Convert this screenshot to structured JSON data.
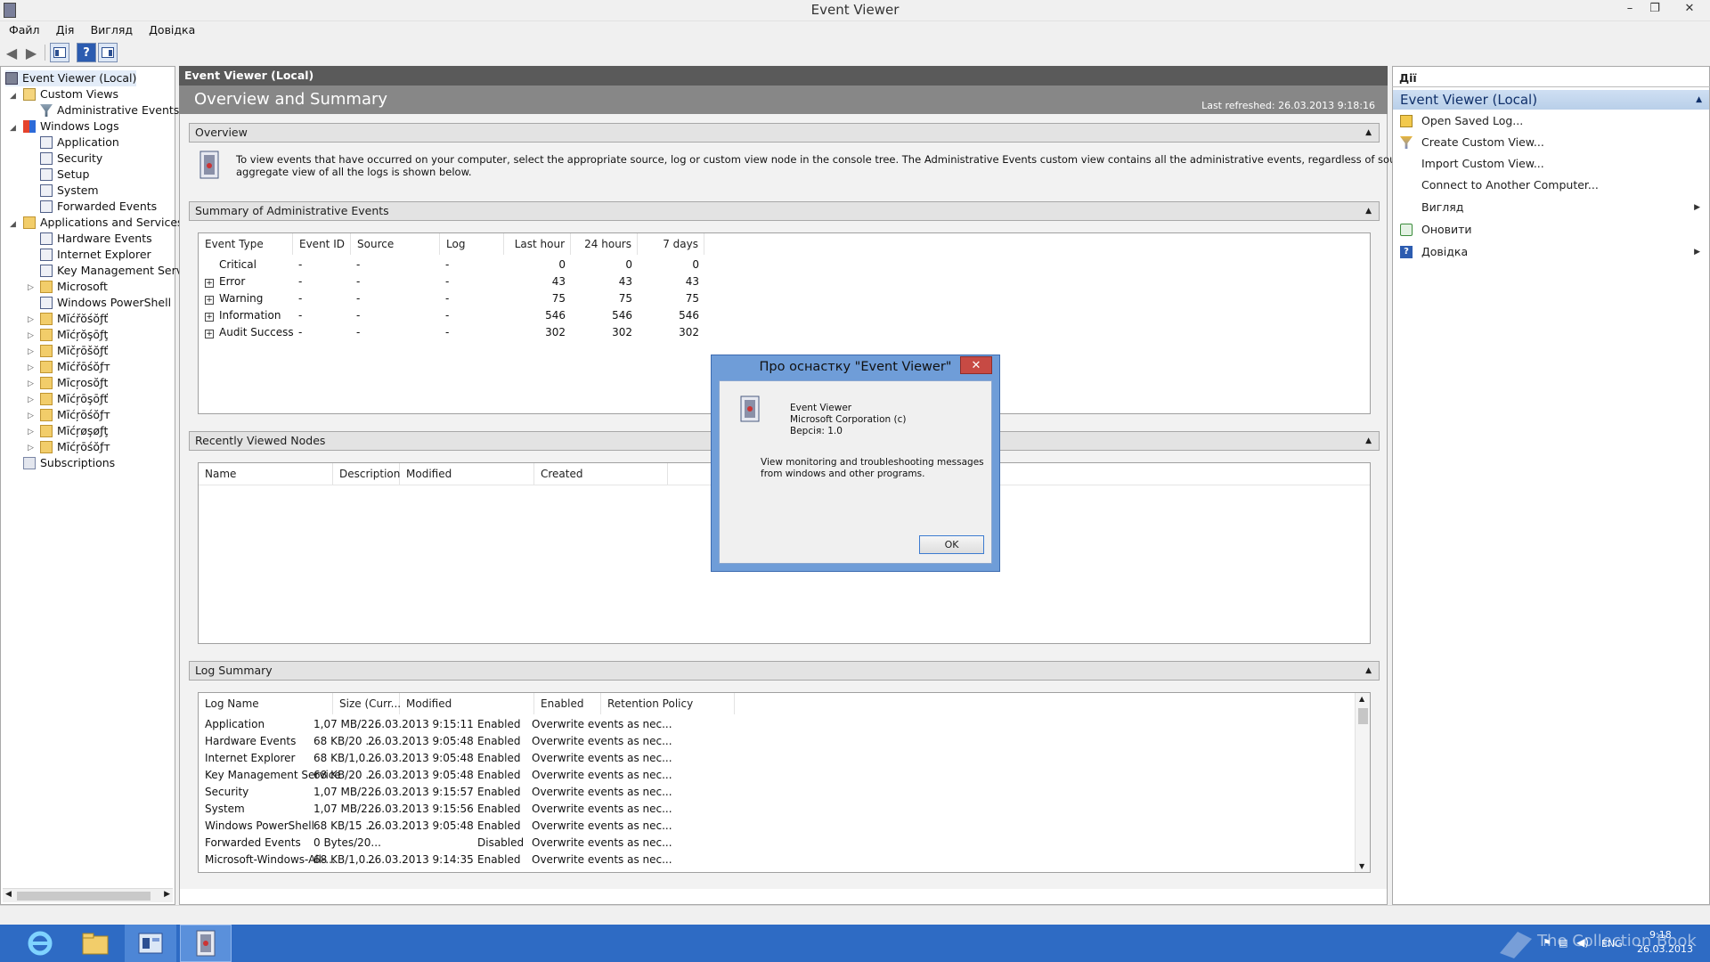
{
  "window": {
    "title": "Event Viewer",
    "minimize": "–",
    "restore": "❐",
    "close": "✕"
  },
  "menu": [
    "Файл",
    "Дія",
    "Вигляд",
    "Довідка"
  ],
  "toolbar": {
    "back": "◀",
    "forward": "▶",
    "help": "?"
  },
  "tree": {
    "root": "Event Viewer (Local)",
    "custom_views": "Custom Views",
    "admin_events": "Administrative Events",
    "windows_logs": "Windows Logs",
    "logs": [
      "Application",
      "Security",
      "Setup",
      "System",
      "Forwarded Events"
    ],
    "apps_services": "Applications and Services Lo",
    "app_logs": [
      "Hardware Events",
      "Internet Explorer",
      "Key Management Service",
      "Microsoft",
      "Windows PowerShell"
    ],
    "microsoft_folders": [
      "Mĭćřŏśŏƒť",
      "Mīćŗŏşōƒţ",
      "Mīčŗōšŏƒť",
      "Mīćřōśŏƒт",
      "Mīcŗosŏƒt",
      "Mīćŗōşōƒť",
      "Mīćŗōśŏƒт",
      "Mīćŗøşøƒţ",
      "Mīćŗōśŏƒт"
    ],
    "subscriptions": "Subscriptions",
    "scroll_left": "◀",
    "scroll_right": "▶"
  },
  "center": {
    "header": "Event Viewer (Local)",
    "title": "Overview and Summary",
    "last_refreshed": "Last refreshed: 26.03.2013 9:18:16",
    "overview": {
      "title": "Overview",
      "text_line1": "To view events that have occurred on your computer, select the appropriate source, log or custom view node in the console tree. The Administrative Events custom view contains all the administrative events, regardless of source. An",
      "text_line2": "aggregate view of all the logs is shown below."
    },
    "summary": {
      "title": "Summary of Administrative Events",
      "columns": [
        "Event Type",
        "Event ID",
        "Source",
        "Log",
        "Last hour",
        "24 hours",
        "7 days"
      ],
      "rows": [
        {
          "type": "Critical",
          "id": "-",
          "source": "-",
          "log": "-",
          "hour": "0",
          "day": "0",
          "week": "0",
          "expand": ""
        },
        {
          "type": "Error",
          "id": "-",
          "source": "-",
          "log": "-",
          "hour": "43",
          "day": "43",
          "week": "43",
          "expand": "+"
        },
        {
          "type": "Warning",
          "id": "-",
          "source": "-",
          "log": "-",
          "hour": "75",
          "day": "75",
          "week": "75",
          "expand": "+"
        },
        {
          "type": "Information",
          "id": "-",
          "source": "-",
          "log": "-",
          "hour": "546",
          "day": "546",
          "week": "546",
          "expand": "+"
        },
        {
          "type": "Audit Success",
          "id": "-",
          "source": "-",
          "log": "-",
          "hour": "302",
          "day": "302",
          "week": "302",
          "expand": "+"
        }
      ]
    },
    "recent": {
      "title": "Recently Viewed Nodes",
      "columns": [
        "Name",
        "Description",
        "Modified",
        "Created"
      ]
    },
    "log_summary": {
      "title": "Log Summary",
      "columns": [
        "Log Name",
        "Size (Curr...",
        "Modified",
        "Enabled",
        "Retention Policy"
      ],
      "rows": [
        [
          "Application",
          "1,07 MB/2...",
          "26.03.2013 9:15:11",
          "Enabled",
          "Overwrite events as nec..."
        ],
        [
          "Hardware Events",
          "68 KB/20 ...",
          "26.03.2013 9:05:48",
          "Enabled",
          "Overwrite events as nec..."
        ],
        [
          "Internet Explorer",
          "68 KB/1,0...",
          "26.03.2013 9:05:48",
          "Enabled",
          "Overwrite events as nec..."
        ],
        [
          "Key Management Service",
          "68 KB/20 ...",
          "26.03.2013 9:05:48",
          "Enabled",
          "Overwrite events as nec..."
        ],
        [
          "Security",
          "1,07 MB/2...",
          "26.03.2013 9:15:57",
          "Enabled",
          "Overwrite events as nec..."
        ],
        [
          "System",
          "1,07 MB/2...",
          "26.03.2013 9:15:56",
          "Enabled",
          "Overwrite events as nec..."
        ],
        [
          "Windows PowerShell",
          "68 KB/15 ...",
          "26.03.2013 9:05:48",
          "Enabled",
          "Overwrite events as nec..."
        ],
        [
          "Forwarded Events",
          "0 Bytes/20...",
          "",
          "Disabled",
          "Overwrite events as nec..."
        ],
        [
          "Microsoft-Windows-All-...",
          "68 KB/1,0...",
          "26.03.2013 9:14:35",
          "Enabled",
          "Overwrite events as nec..."
        ]
      ]
    }
  },
  "actions": {
    "header": "Дії",
    "group": "Event Viewer (Local)",
    "items": [
      "Open Saved Log...",
      "Create Custom View...",
      "Import Custom View...",
      "Connect to Another Computer...",
      "Вигляд",
      "Оновити",
      "Довідка"
    ]
  },
  "dialog": {
    "title": "Про оснастку \"Event Viewer\"",
    "close": "✕",
    "name": "Event Viewer",
    "company": "Microsoft Corporation (c)",
    "version": "Версія: 1.0",
    "desc_line1": "View monitoring and troubleshooting messages",
    "desc_line2": "from windows and other programs.",
    "ok": "OK"
  },
  "taskbar": {
    "lang": "ENG",
    "time": "9:18",
    "date": "26.03.2013",
    "watermark": "The Collection Book"
  }
}
